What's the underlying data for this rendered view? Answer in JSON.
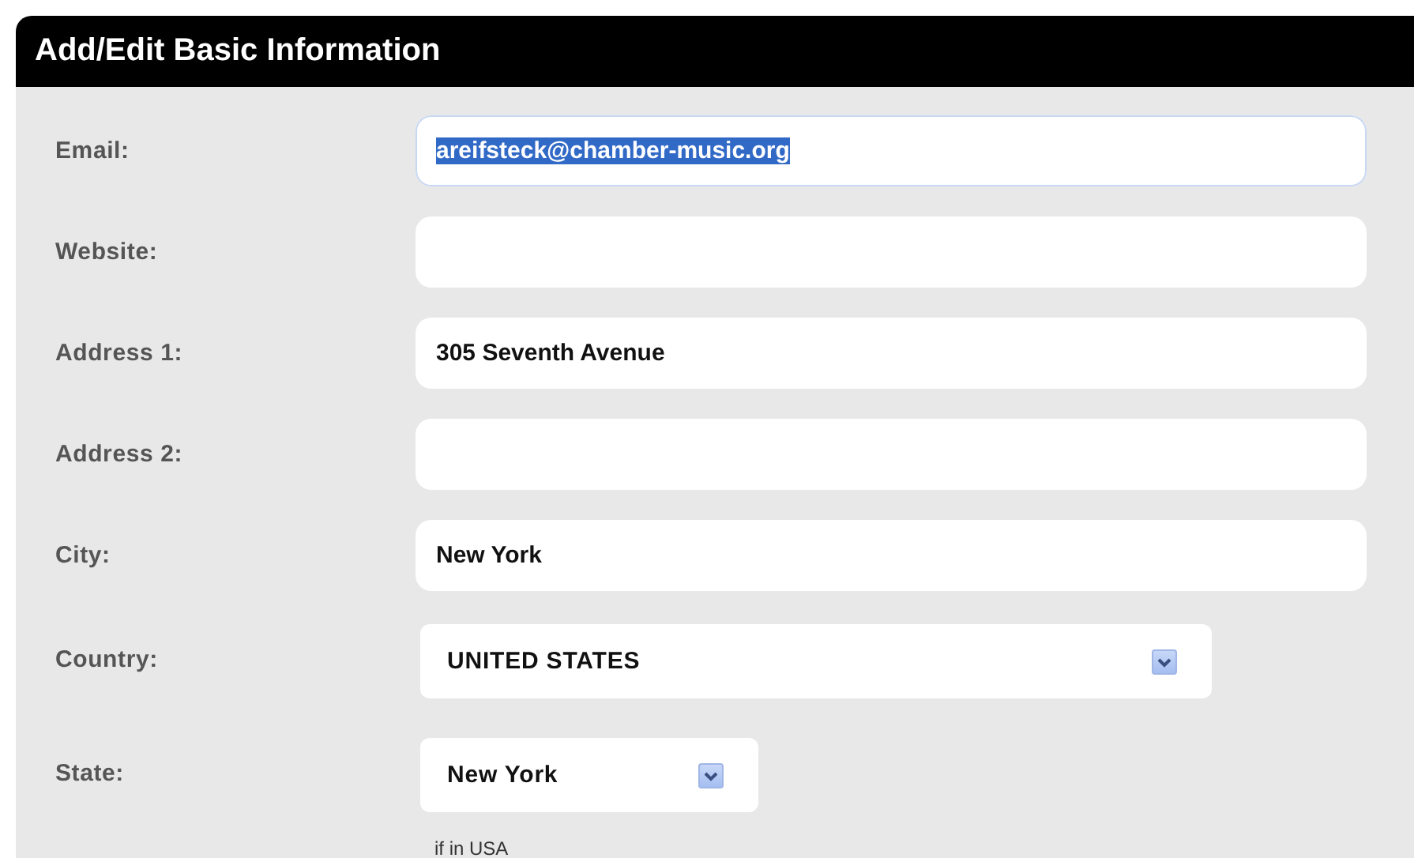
{
  "panel": {
    "title": "Add/Edit Basic Information"
  },
  "fields": [
    {
      "kind": "text",
      "label": "Email:",
      "value": "areifsteck@chamber-music.org",
      "selected": true
    },
    {
      "kind": "text",
      "label": "Website:",
      "selected": false
    },
    {
      "kind": "text",
      "label": "Address 1:",
      "value": "305 Seventh Avenue",
      "selected": false
    },
    {
      "kind": "text",
      "label": "Address 2:",
      "selected": false
    },
    {
      "kind": "text",
      "label": "City:",
      "value": "New York",
      "selected": false
    },
    {
      "kind": "select",
      "label": "Country:",
      "value": "UNITED STATES"
    },
    {
      "kind": "shortselect",
      "label": "State:",
      "value": "New York",
      "hint": "if in USA"
    }
  ]
}
